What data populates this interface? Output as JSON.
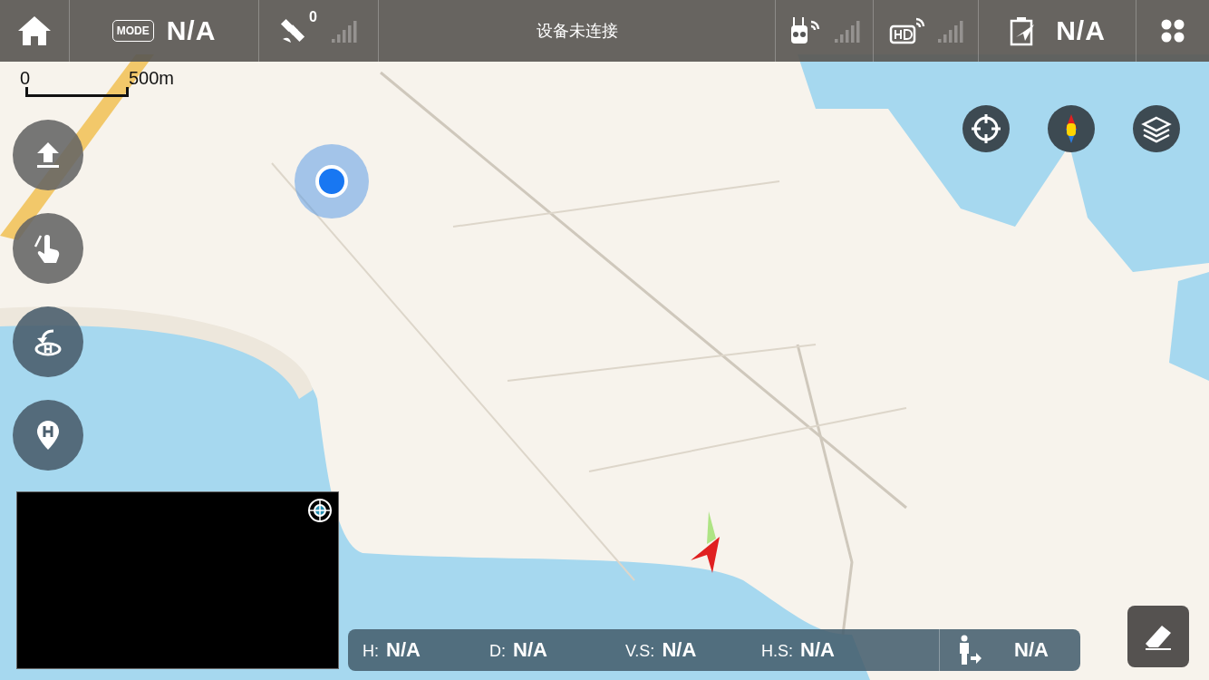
{
  "top_bar": {
    "mode_label": "MODE",
    "mode_value": "N/A",
    "satellite_count": "0",
    "status": "设备未连接",
    "battery_value": "N/A"
  },
  "scale_bar": {
    "start": "0",
    "end": "500m"
  },
  "telemetry": [
    {
      "label": "H:",
      "value": "N/A"
    },
    {
      "label": "D:",
      "value": "N/A"
    },
    {
      "label": "V.S:",
      "value": "N/A"
    },
    {
      "label": "H.S:",
      "value": "N/A"
    }
  ],
  "pilot_distance": "N/A"
}
